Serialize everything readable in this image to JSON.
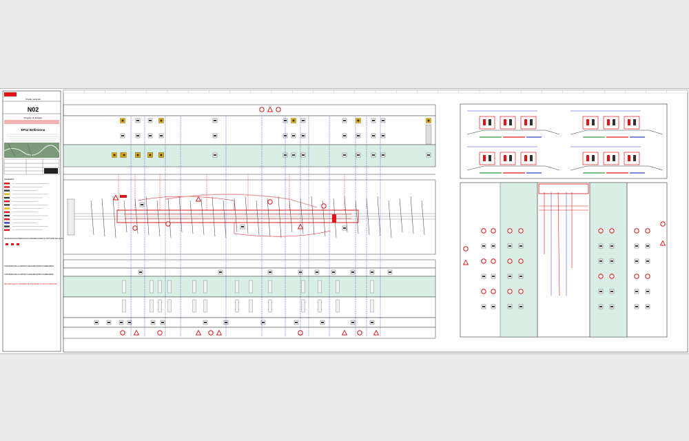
{
  "title_block": {
    "office_label": "Strade nazionali",
    "road_code": "N02",
    "subtitle": "EP12 Bellinzona",
    "variant": "Progetto di dettaglio",
    "legend_heading": "LEGENDA",
    "note_1": "SEGNALETICA DI PREAVVISO DI CANTIERE DIURNO E NOTTURNO SULLE CORSIE DI SORPASSO",
    "note_2": "LUNGHEZZA DELLA CORSIA DI DECELERAZIONE DI EMERGENZA",
    "note_3": "LUNGHEZZA DELLA CORSIA DI ACCELERAZIONE DI EMERGENZA",
    "note_4": "PER SEGNALETICA DIFFERENTE INTEGRARE IL PIANO DI PREAVVISO"
  },
  "colors": {
    "sheet": "#ffffff",
    "frame": "#333333",
    "accent_red": "#e01414",
    "accent_blue": "#2b3fd0",
    "band_green": "#d9efe6",
    "road_gray": "#8a8a8a",
    "map_green": "#7a9a7a"
  },
  "icons": [
    "warning-sign-icon",
    "stop-sign-icon",
    "lane-arrow-icon",
    "barrier-icon"
  ]
}
